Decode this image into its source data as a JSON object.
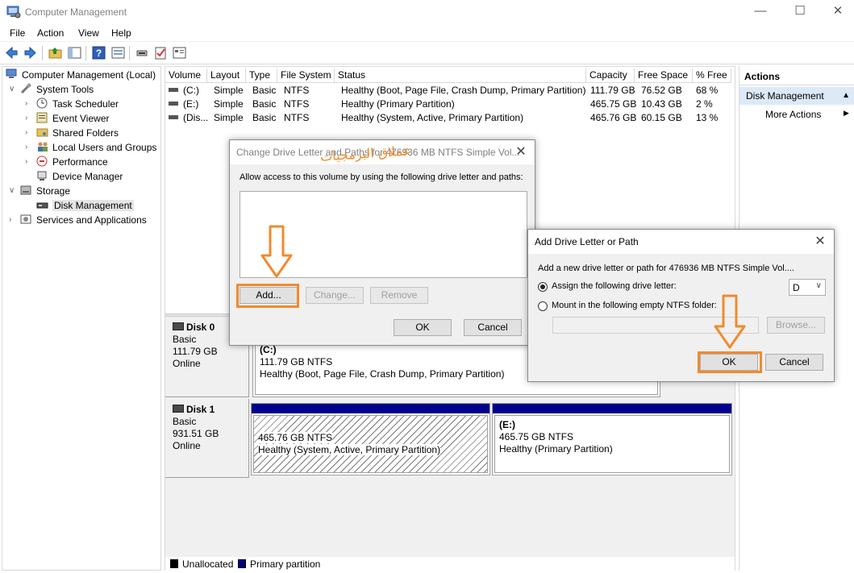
{
  "window": {
    "title": "Computer Management",
    "minimize_icon": "minimize-icon",
    "maximize_icon": "maximize-icon",
    "close_icon": "close-icon"
  },
  "menu": [
    "File",
    "Action",
    "View",
    "Help"
  ],
  "tree": {
    "root": "Computer Management (Local)",
    "system_tools": "System Tools",
    "task_scheduler": "Task Scheduler",
    "event_viewer": "Event Viewer",
    "shared_folders": "Shared Folders",
    "local_users": "Local Users and Groups",
    "performance": "Performance",
    "device_manager": "Device Manager",
    "storage": "Storage",
    "disk_management": "Disk Management",
    "services": "Services and Applications"
  },
  "volume_table": {
    "headers": [
      "Volume",
      "Layout",
      "Type",
      "File System",
      "Status",
      "Capacity",
      "Free Space",
      "% Free"
    ],
    "rows": [
      [
        "(C:)",
        "Simple",
        "Basic",
        "NTFS",
        "Healthy (Boot, Page File, Crash Dump, Primary Partition)",
        "111.79 GB",
        "76.52 GB",
        "68 %"
      ],
      [
        "(E:)",
        "Simple",
        "Basic",
        "NTFS",
        "Healthy (Primary Partition)",
        "465.75 GB",
        "10.43 GB",
        "2 %"
      ],
      [
        "(Dis...",
        "Simple",
        "Basic",
        "NTFS",
        "Healthy (System, Active, Primary Partition)",
        "465.76 GB",
        "60.15 GB",
        "13 %"
      ]
    ]
  },
  "disks": [
    {
      "name": "Disk 0",
      "type": "Basic",
      "size": "111.79 GB",
      "status": "Online",
      "partition": {
        "label": "(C:)",
        "size": "111.79 GB NTFS",
        "health": "Healthy (Boot, Page File, Crash Dump, Primary Partition)"
      }
    },
    {
      "name": "Disk 1",
      "type": "Basic",
      "size": "931.51 GB",
      "status": "Online",
      "partitions": [
        {
          "size": "465.76 GB NTFS",
          "health": "Healthy (System, Active, Primary Partition)"
        },
        {
          "label": "(E:)",
          "size": "465.75 GB NTFS",
          "health": "Healthy (Primary Partition)"
        }
      ]
    }
  ],
  "legend": {
    "unallocated": "Unallocated",
    "primary": "Primary partition",
    "unallocated_color": "#000000",
    "primary_color": "#00008b"
  },
  "actions": {
    "header": "Actions",
    "selected": "Disk Management",
    "more": "More Actions"
  },
  "dialog_change": {
    "title": "Change Drive Letter and Paths for 476936 MB NTFS Simple Vol...",
    "prompt": "Allow access to this volume by using the following drive letter and paths:",
    "add": "Add...",
    "change": "Change...",
    "remove": "Remove",
    "ok": "OK",
    "cancel": "Cancel",
    "watermark": "عملاق البرمجيات"
  },
  "dialog_add": {
    "title": "Add Drive Letter or Path",
    "prompt": "Add a new drive letter or path for 476936 MB NTFS Simple Vol....",
    "assign": "Assign the following drive letter:",
    "drive_letter": "D",
    "mount": "Mount in the following empty NTFS folder:",
    "browse": "Browse...",
    "ok": "OK",
    "cancel": "Cancel"
  },
  "colors": {
    "highlight": "#f08b2e",
    "selection": "#dce9f7",
    "partition_bar": "#00008b"
  }
}
